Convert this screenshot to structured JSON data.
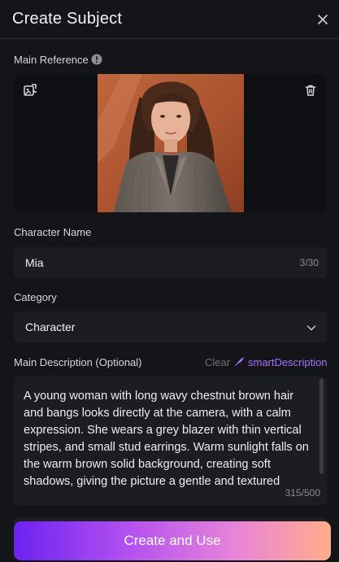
{
  "dialog": {
    "title": "Create Subject",
    "close_icon": "close-icon"
  },
  "main_reference": {
    "label": "Main Reference",
    "info_icon": "info-icon",
    "replace_icon": "image-replace-icon",
    "delete_icon": "trash-icon"
  },
  "character_name": {
    "label": "Character Name",
    "value": "Mia",
    "counter": "3/30"
  },
  "category": {
    "label": "Category",
    "selected": "Character",
    "chevron_icon": "chevron-down-icon"
  },
  "description": {
    "label": "Main Description (Optional)",
    "clear_label": "Clear",
    "smart_label": "smartDescription",
    "smart_icon": "feather-icon",
    "text": "A young woman with long wavy chestnut brown hair and bangs looks directly at the camera, with a calm expression. She wears a grey blazer with thin vertical stripes, and small stud earrings. Warm sunlight falls on the warm brown solid background, creating soft shadows, giving the picture a gentle and textured",
    "counter": "315/500"
  },
  "actions": {
    "create_label": "Create and Use"
  },
  "colors": {
    "background": "#141519",
    "field": "#1c1d22",
    "accent": "#a970ff",
    "gradient_start": "#6b23f0",
    "gradient_end": "#ffad8a"
  }
}
